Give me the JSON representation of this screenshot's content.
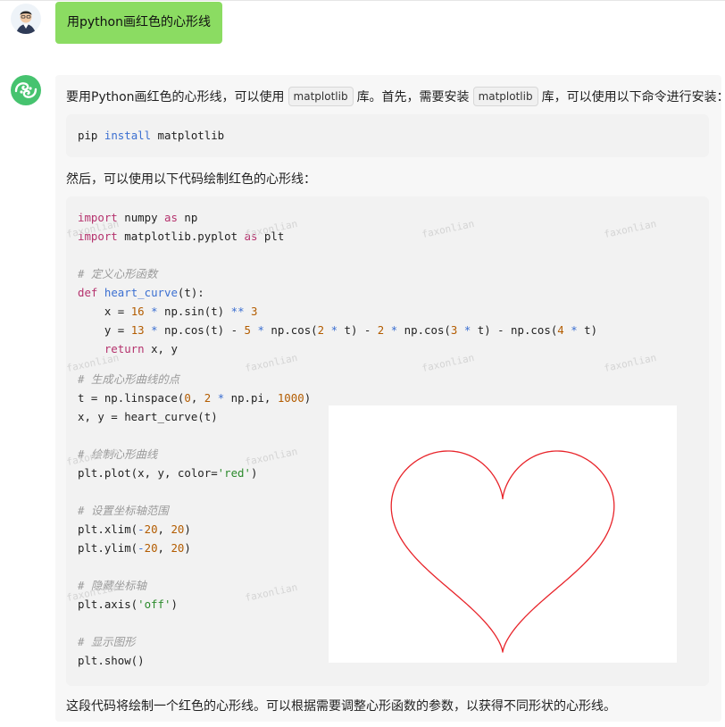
{
  "user_message": {
    "text": "用python画红色的心形线"
  },
  "assistant": {
    "intro_before": "要用Python画红色的心形线，可以使用",
    "intro_code1": "matplotlib",
    "intro_middle": "库。首先，需要安装",
    "intro_code2": "matplotlib",
    "intro_after": "库，可以使用以下命令进行安装：",
    "install_cmd": {
      "cmd1": "pip",
      "cmd2": "install",
      "cmd3": "matplotlib"
    },
    "then_text": "然后，可以使用以下代码绘制红色的心形线：",
    "code": {
      "l1_kw1": "import",
      "l1_mod": "numpy",
      "l1_kw2": "as",
      "l1_alias": "np",
      "l2_kw1": "import",
      "l2_mod": "matplotlib.pyplot",
      "l2_kw2": "as",
      "l2_alias": "plt",
      "c1": "# 定义心形函数",
      "l4_kw": "def",
      "l4_fn": "heart_curve",
      "l4_rest": "(t):",
      "l5": "    x = 16 * np.sin(t) ** 3",
      "l6": "    y = 13 * np.cos(t) - 5 * np.cos(2 * t) - 2 * np.cos(3 * t) - np.cos(4 * t)",
      "l7_kw": "    return",
      "l7_rest": " x, y",
      "c2": "# 生成心形曲线的点",
      "l9": "t = np.linspace(0, 2 * np.pi, 1000)",
      "l10": "x, y = heart_curve(t)",
      "c3": "# 绘制心形曲线",
      "l12_a": "plt.plot(x, y, color=",
      "l12_str": "'red'",
      "l12_b": ")",
      "c4": "# 设置坐标轴范围",
      "l14": "plt.xlim(-20, 20)",
      "l15": "plt.ylim(-20, 20)",
      "c5": "# 隐藏坐标轴",
      "l17_a": "plt.axis(",
      "l17_str": "'off'",
      "l17_b": ")",
      "c6": "# 显示图形",
      "l19": "plt.show()"
    },
    "conclusion": "这段代码将绘制一个红色的心形线。可以根据需要调整心形函数的参数，以获得不同形状的心形线。"
  },
  "watermark_text": "faxonlian",
  "heart_plot": {
    "color": "#e8242a",
    "xlim": [
      -20,
      20
    ],
    "ylim": [
      -20,
      20
    ],
    "axis": "off"
  },
  "colors": {
    "user_bubble": "#8bdc62",
    "bot_avatar": "#46c36f",
    "panel": "#f7f7f7"
  }
}
